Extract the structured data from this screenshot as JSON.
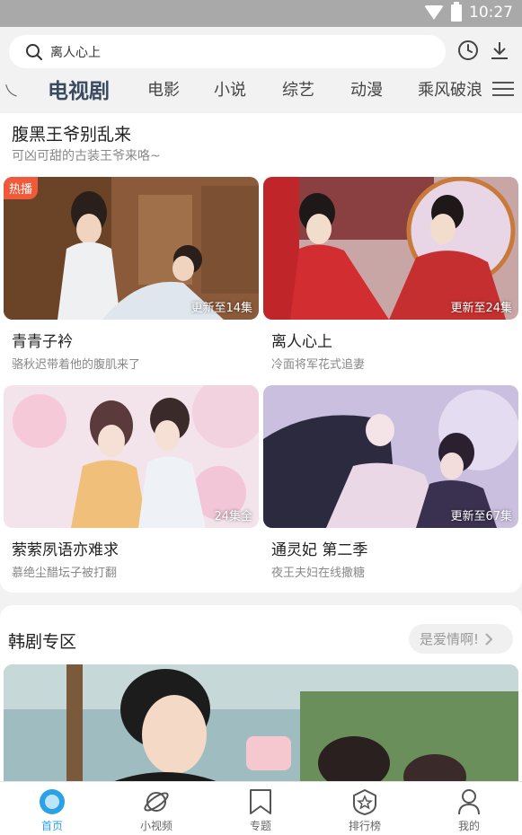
{
  "status_bar": {
    "time": "10:27"
  },
  "search": {
    "placeholder": "离人心上"
  },
  "tabs": {
    "partial": "乀",
    "items": [
      "电视剧",
      "电影",
      "小说",
      "综艺",
      "动漫",
      "乘风破浪"
    ],
    "active_index": 0
  },
  "section": {
    "title": "腹黑王爷别乱来",
    "subtitle": "可凶可甜的古装王爷来咯~",
    "items": [
      {
        "title": "青青子衿",
        "desc": "骆秋迟带着他的腹肌来了",
        "badge": "热播",
        "update": "更新至14集"
      },
      {
        "title": "离人心上",
        "desc": "冷面将军花式追妻",
        "update": "更新至24集"
      },
      {
        "title": "萦萦夙语亦难求",
        "desc": "慕绝尘醋坛子被打翻",
        "update": "24集全"
      },
      {
        "title": "通灵妃 第二季",
        "desc": "夜王夫妇在线撒糖",
        "update": "更新至67集"
      }
    ]
  },
  "korea": {
    "title": "韩剧专区",
    "more_label": "是爱情啊!"
  },
  "bottom_nav": [
    {
      "label": "首页",
      "icon": "home-icon",
      "active": true
    },
    {
      "label": "小视频",
      "icon": "planet-icon"
    },
    {
      "label": "专题",
      "icon": "bookmark-icon"
    },
    {
      "label": "排行榜",
      "icon": "badge-star-icon"
    },
    {
      "label": "我的",
      "icon": "user-icon"
    }
  ],
  "colors": {
    "accent": "#2aa2e6",
    "badge": "#f05a3a",
    "active_tab": "#3a4a60"
  }
}
